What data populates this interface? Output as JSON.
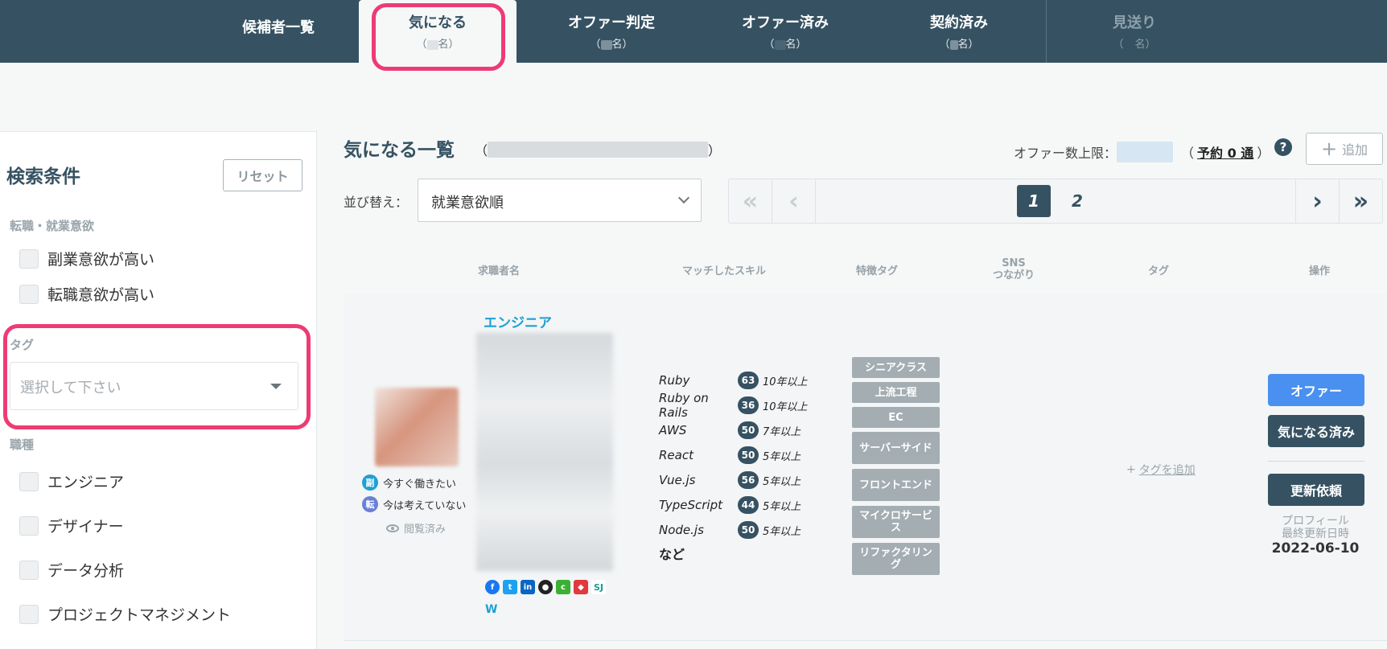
{
  "nav": {
    "tabs": [
      {
        "label": "候補者一覧",
        "count": ""
      },
      {
        "label": "気になる",
        "count_prefix": "（",
        "count_suffix": "名）"
      },
      {
        "label": "オファー判定",
        "count_prefix": "（",
        "count_suffix": "名）"
      },
      {
        "label": "オファー済み",
        "count_prefix": "（",
        "count_suffix": "名）"
      },
      {
        "label": "契約済み",
        "count_prefix": "（",
        "count_suffix": "名）"
      },
      {
        "label": "見送り",
        "count_prefix": "（",
        "count_suffix": "名）"
      }
    ],
    "active_index": 1
  },
  "sidebar": {
    "title": "検索条件",
    "reset_label": "リセット",
    "section_motivation": "転職・就業意欲",
    "motivation_options": [
      "副業意欲が高い",
      "転職意欲が高い"
    ],
    "section_tag": "タグ",
    "tag_placeholder": "選択して下さい",
    "section_job": "職種",
    "job_options": [
      "エンジニア",
      "デザイナー",
      "データ分析",
      "プロジェクトマネジメント"
    ]
  },
  "main": {
    "title": "気になる一覧",
    "paren_open": "（",
    "paren_close": "）",
    "offer_limit_label": "オファー数上限：",
    "reserve_open": "（",
    "reserve_link": "予約 0 通",
    "reserve_close": "）",
    "help_icon": "?",
    "add_label": "追加",
    "sort_label": "並び替え：",
    "sort_value": "就業意欲順",
    "pages": [
      "1",
      "2"
    ],
    "current_page": "1"
  },
  "columns": {
    "name": "求職者名",
    "skills": "マッチしたスキル",
    "features": "特徴タグ",
    "sns_line1": "SNS",
    "sns_line2": "つながり",
    "tags": "タグ",
    "actions": "操作"
  },
  "candidate": {
    "job_title": "エンジニア",
    "status_work": "今すぐ働きたい",
    "status_work_badge": "副",
    "status_change": "今は考えていない",
    "status_change_badge": "転",
    "viewed": "閲覧済み",
    "skills": [
      {
        "name": "Ruby",
        "score": "63",
        "years": "10年以上"
      },
      {
        "name": "Ruby on Rails",
        "score": "36",
        "years": "10年以上"
      },
      {
        "name": "AWS",
        "score": "50",
        "years": "7年以上"
      },
      {
        "name": "React",
        "score": "50",
        "years": "5年以上"
      },
      {
        "name": "Vue.js",
        "score": "56",
        "years": "5年以上"
      },
      {
        "name": "TypeScript",
        "score": "44",
        "years": "5年以上"
      },
      {
        "name": "Node.js",
        "score": "50",
        "years": "5年以上"
      }
    ],
    "skills_more": "など",
    "feature_tags": [
      "シニアクラス",
      "上流工程",
      "EC",
      "サーバーサイド",
      "フロントエンド",
      "マイクロサービス",
      "リファクタリング"
    ],
    "sns": [
      "facebook-icon",
      "twitter-icon",
      "linkedin-icon",
      "github-icon",
      "connpass-icon",
      "speakerdeck-icon",
      "sj-icon",
      "wantedly-icon"
    ],
    "sns_sj": "SJ",
    "sns_w": "W",
    "tag_add": "タグを追加",
    "btn_offer": "オファー",
    "btn_saved": "気になる済み",
    "btn_update": "更新依頼",
    "profile_updated_line1": "プロフィール",
    "profile_updated_line2": "最終更新日時",
    "profile_updated_date": "2022-06-10"
  },
  "colors": {
    "nav_bg": "#365262",
    "highlight": "#ee3b74",
    "offer_btn": "#4a90f0",
    "dark_btn": "#365262",
    "feature_tag": "#a3adb2",
    "link": "#1ea0d4"
  }
}
